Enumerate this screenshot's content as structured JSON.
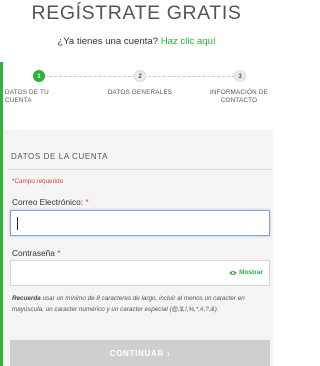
{
  "header": {
    "title": "REGÍSTRATE GRATIS",
    "login_prompt": "¿Ya tienes una cuenta?",
    "login_link": "Haz clic aquí"
  },
  "colors": {
    "accent": "#27b334",
    "required": "#e0453c",
    "button_disabled": "#cfcfcf",
    "focus_border": "#7fa6d9"
  },
  "steps": [
    {
      "number": "1",
      "label": "DATOS DE TU CUENTA",
      "active": true
    },
    {
      "number": "2",
      "label": "DATOS GENERALES",
      "active": false
    },
    {
      "number": "3",
      "label_line1": "INFORMACIÓN DE",
      "label_line2": "CONTACTO",
      "active": false
    }
  ],
  "form": {
    "section_title": "DATOS DE LA CUENTA",
    "required_note": "*Campo requerido",
    "email": {
      "label": "Correo Electrónico:",
      "required_mark": "*",
      "value": ""
    },
    "password": {
      "label": "Contraseña",
      "required_mark": "*",
      "value": "",
      "show_label": "Mostrar",
      "show_icon": "eye-icon"
    },
    "hint_bold": "Recuerda",
    "hint_text": " usar un mínimo de 8 caracteres de largo, incluir al menos un caracter en mayúscula, un caracter numérico y un caracter especial (@,$,!,%,*,#,?,&).",
    "submit_label": "CONTINUAR",
    "submit_icon": "chevron-right-icon"
  }
}
